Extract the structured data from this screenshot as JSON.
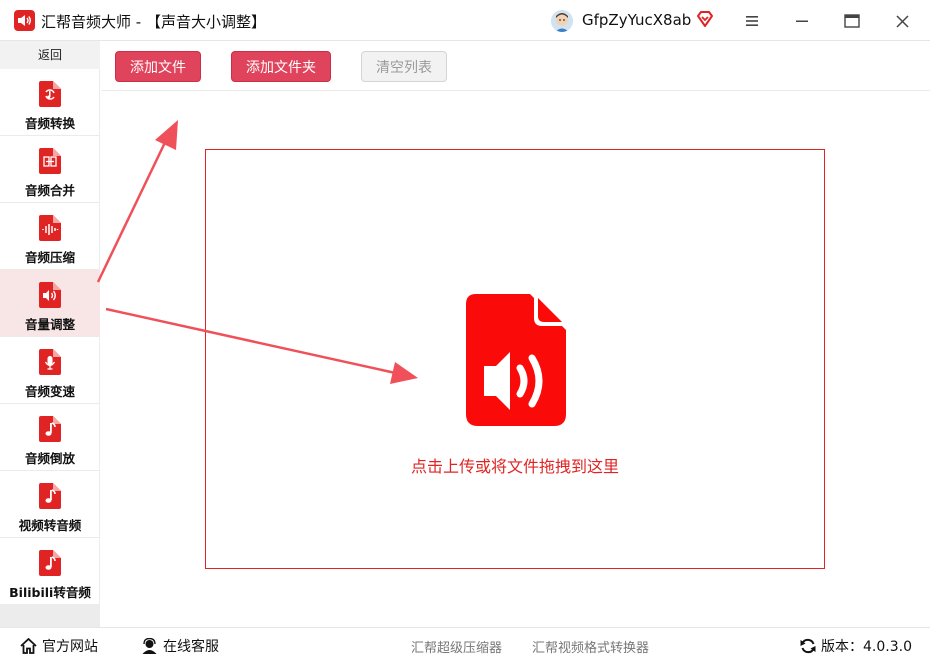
{
  "titlebar": {
    "app_name": "汇帮音频大师",
    "page_suffix": " - 【声音大小调整】",
    "username": "GfpZyYucX8ab"
  },
  "sidebar": {
    "back_label": "返回",
    "items": [
      {
        "label": "音频转换",
        "icon": "audio-convert-icon"
      },
      {
        "label": "音频合并",
        "icon": "audio-merge-icon"
      },
      {
        "label": "音频压缩",
        "icon": "audio-compress-icon"
      },
      {
        "label": "音量调整",
        "icon": "volume-adjust-icon",
        "active": true
      },
      {
        "label": "音频变速",
        "icon": "audio-speed-icon"
      },
      {
        "label": "音频倒放",
        "icon": "audio-reverse-icon"
      },
      {
        "label": "视频转音频",
        "icon": "video-to-audio-icon"
      },
      {
        "label": "Bilibili转音频",
        "icon": "bilibili-to-audio-icon"
      }
    ]
  },
  "toolbar": {
    "add_file": "添加文件",
    "add_folder": "添加文件夹",
    "clear_list": "清空列表"
  },
  "dropzone": {
    "hint": "点击上传或将文件拖拽到这里"
  },
  "statusbar": {
    "website": "官方网站",
    "support": "在线客服",
    "link1": "汇帮超级压缩器",
    "link2": "汇帮视频格式转换器",
    "version": "版本：4.0.3.0"
  },
  "colors": {
    "brand_red": "#e02424",
    "button_red": "#e0435c",
    "active_bg": "#f8e6e6"
  }
}
